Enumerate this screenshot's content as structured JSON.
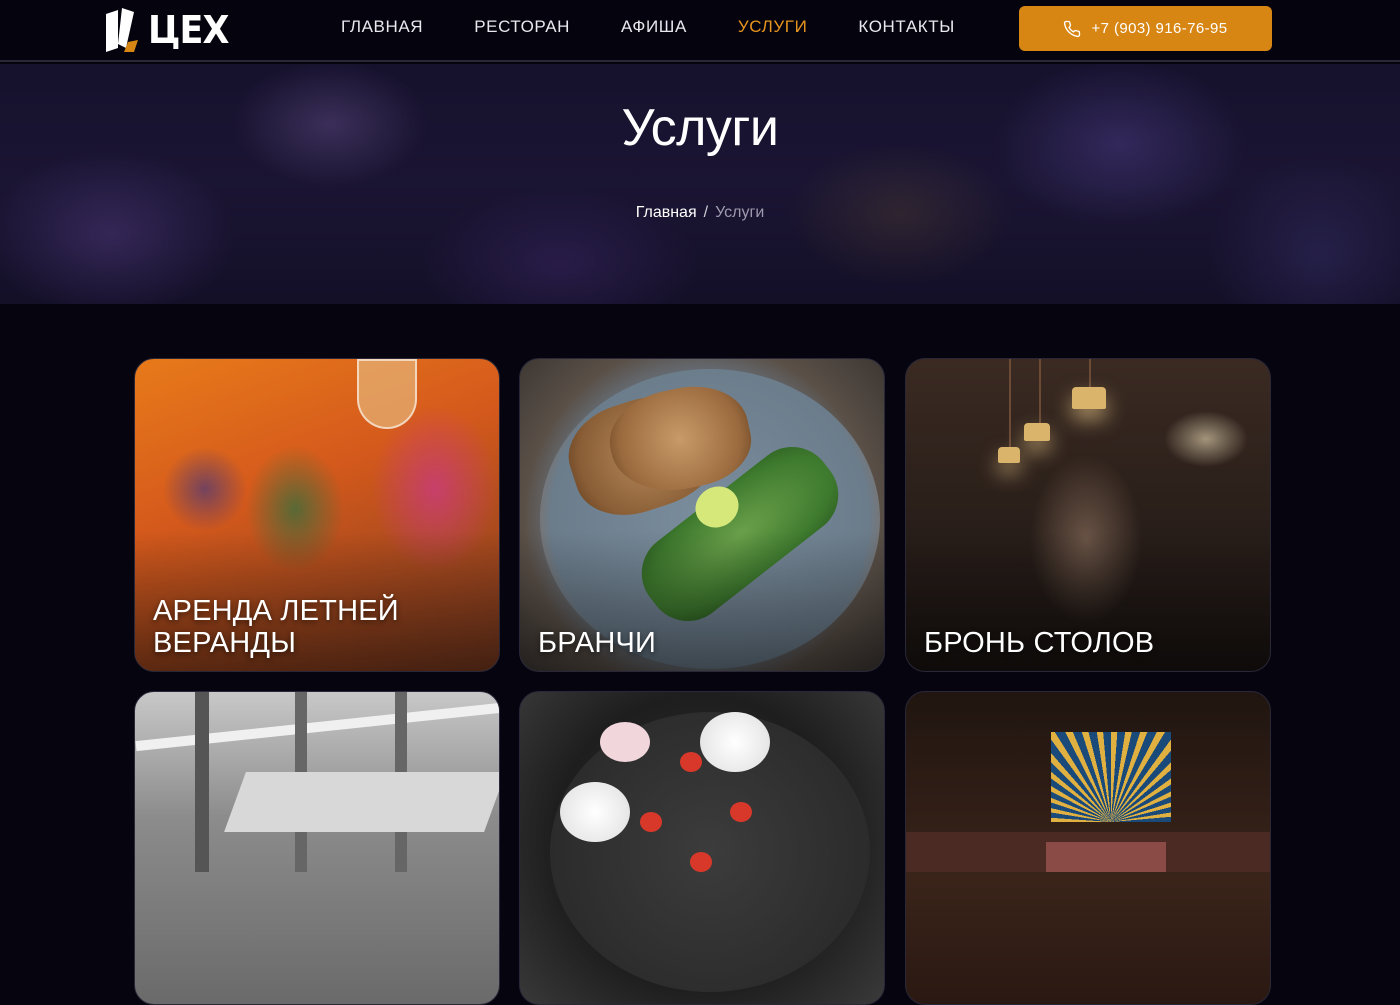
{
  "header": {
    "logo_text": "ЦЕХ",
    "nav": [
      "ГЛАВНАЯ",
      "РЕСТОРАН",
      "АФИША",
      "УСЛУГИ",
      "КОНТАКТЫ"
    ],
    "active_nav": "УСЛУГИ",
    "phone": "+7 (903) 916-76-95"
  },
  "hero": {
    "title": "Услуги",
    "breadcrumb": {
      "home": "Главная",
      "separator": "/",
      "current": "Услуги"
    }
  },
  "services": [
    {
      "label": "Аренда летней веранды"
    },
    {
      "label": "Бранчи"
    },
    {
      "label": "Бронь столов"
    },
    {
      "label": ""
    },
    {
      "label": ""
    },
    {
      "label": ""
    }
  ],
  "colors": {
    "accent": "#d78614",
    "nav_active": "#e8961f",
    "background": "#06040f"
  },
  "icons": {
    "phone": "phone-icon",
    "logo": "logo-icon"
  }
}
